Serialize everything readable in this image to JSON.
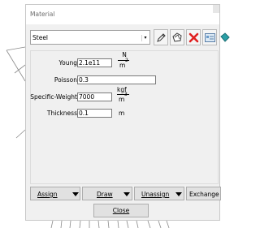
{
  "window": {
    "title": "Material"
  },
  "material": {
    "selected": "Steel"
  },
  "toolbar": {
    "icons": [
      "edit-pencil-icon",
      "polygon-shape-icon",
      "delete-x-icon",
      "properties-card-icon",
      "paint-bucket-icon"
    ],
    "colors": {
      "delete": "#e02020",
      "teal": "#2a9fa6"
    }
  },
  "properties": {
    "young": {
      "label": "Young",
      "value": "2.1e11",
      "unit_num": "N",
      "unit_den": "m",
      "unit_exp": "2"
    },
    "poisson": {
      "label": "Poisson",
      "value": "0.3"
    },
    "specific_weight": {
      "label": "Specific-Weight",
      "value": "7000",
      "unit_num": "kgf",
      "unit_den": "m",
      "unit_exp": "3"
    },
    "thickness": {
      "label": "Thickness",
      "value": "0.1",
      "unit": "m"
    }
  },
  "actions": {
    "assign": "Assign",
    "draw": "Draw",
    "unassign": "Unassign",
    "exchange": "Exchange"
  },
  "close_label": "Close"
}
